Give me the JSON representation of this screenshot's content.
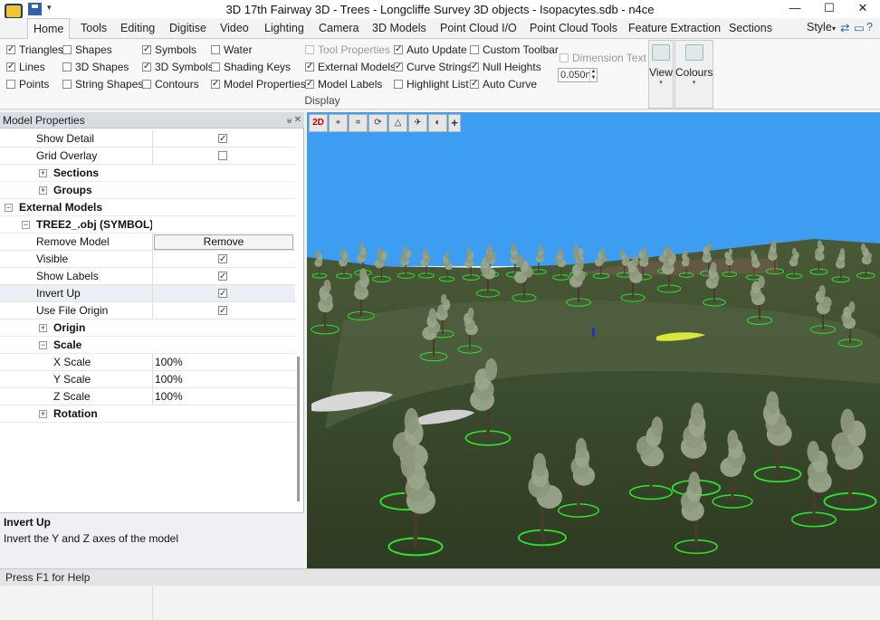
{
  "window": {
    "title": "3D 17th Fairway 3D - Trees - Longcliffe Survey 3D objects - Isopacytes.sdb - n4ce",
    "minimize": "—",
    "maximize": "☐",
    "close": "✕"
  },
  "tabs": [
    "Home",
    "Tools",
    "Editing",
    "Digitise",
    "Video",
    "Lighting",
    "Camera",
    "3D Models",
    "Point Cloud I/O",
    "Point Cloud Tools",
    "Feature Extraction",
    "Sections"
  ],
  "active_tab": "Home",
  "style_label": "Style",
  "ribbon": {
    "checks": [
      {
        "label": "Triangles",
        "checked": true
      },
      {
        "label": "Lines",
        "checked": true
      },
      {
        "label": "Points",
        "checked": false
      },
      {
        "label": "Shapes",
        "checked": false
      },
      {
        "label": "3D Shapes",
        "checked": false
      },
      {
        "label": "String Shapes",
        "checked": false
      },
      {
        "label": "Symbols",
        "checked": true
      },
      {
        "label": "3D Symbols",
        "checked": true
      },
      {
        "label": "Contours",
        "checked": false
      },
      {
        "label": "Water",
        "checked": false
      },
      {
        "label": "Shading Keys",
        "checked": false
      },
      {
        "label": "Model Properties",
        "checked": true
      },
      {
        "label": "Tool Properties",
        "checked": false,
        "disabled": true
      },
      {
        "label": "External Models",
        "checked": true
      },
      {
        "label": "Model Labels",
        "checked": true
      },
      {
        "label": "Auto Update",
        "checked": true
      },
      {
        "label": "Curve Strings",
        "checked": true
      },
      {
        "label": "Highlight List",
        "checked": false
      },
      {
        "label": "Custom Toolbar",
        "checked": false
      },
      {
        "label": "Null Heights",
        "checked": true
      },
      {
        "label": "Auto Curve",
        "checked": true
      },
      {
        "label": "Dimension Text",
        "checked": false,
        "disabled": true
      }
    ],
    "spin_value": "0.050n",
    "group_label": "Display",
    "view_label": "View",
    "colours_label": "Colours"
  },
  "panel": {
    "title": "Model Properties",
    "rows": [
      {
        "name": "Show Detail",
        "type": "check",
        "checked": true,
        "indent": 40
      },
      {
        "name": "Grid Overlay",
        "type": "check",
        "checked": false,
        "indent": 40
      },
      {
        "name": "Sections",
        "type": "cat",
        "expander": "+",
        "indent": 59
      },
      {
        "name": "Groups",
        "type": "cat",
        "expander": "+",
        "indent": 59
      },
      {
        "name": "External Models",
        "type": "cat",
        "expander": "−",
        "indent": 21
      },
      {
        "name": "TREE2_.obj (SYMBOL)",
        "type": "cat",
        "expander": "−",
        "indent": 40
      },
      {
        "name": "Remove Model",
        "type": "button",
        "button": "Remove",
        "indent": 40
      },
      {
        "name": "Visible",
        "type": "check",
        "checked": true,
        "indent": 40
      },
      {
        "name": "Show Labels",
        "type": "check",
        "checked": true,
        "indent": 40
      },
      {
        "name": "Invert Up",
        "type": "check",
        "checked": true,
        "indent": 40,
        "selected": true
      },
      {
        "name": "Use File Origin",
        "type": "check",
        "checked": true,
        "indent": 40
      },
      {
        "name": "Origin",
        "type": "cat",
        "expander": "+",
        "indent": 59
      },
      {
        "name": "Scale",
        "type": "cat",
        "expander": "−",
        "indent": 59
      },
      {
        "name": "X Scale",
        "type": "text",
        "value": "100%",
        "indent": 59
      },
      {
        "name": "Y Scale",
        "type": "text",
        "value": "100%",
        "indent": 59
      },
      {
        "name": "Z Scale",
        "type": "text",
        "value": "100%",
        "indent": 59
      },
      {
        "name": "Rotation",
        "type": "cat",
        "expander": "+",
        "indent": 59
      }
    ],
    "desc_title": "Invert Up",
    "desc_text": "Invert the Y and Z axes of the model"
  },
  "viewport": {
    "toolbar": [
      "2D",
      "",
      "",
      "",
      "",
      "",
      "",
      "+"
    ]
  },
  "status": "Press F1 for Help",
  "colors": {
    "sky": "#3d9df0",
    "ground": "#3b4a2e",
    "tree": "#9aa58a",
    "marker": "#2ee02e"
  }
}
